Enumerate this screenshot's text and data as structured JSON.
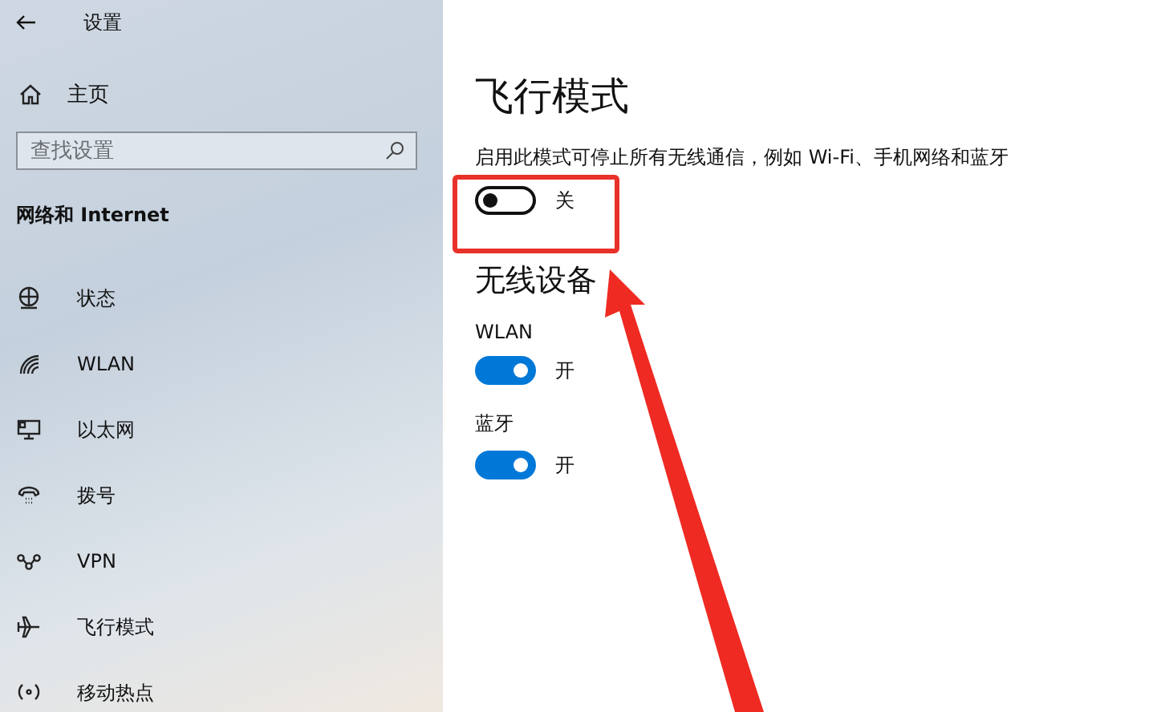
{
  "window": {
    "title": "设置"
  },
  "sidebar": {
    "home": "主页",
    "search": {
      "placeholder": "查找设置"
    },
    "section": "网络和 Internet",
    "items": [
      {
        "kind": "status",
        "label": "状态"
      },
      {
        "kind": "wlan",
        "label": "WLAN"
      },
      {
        "kind": "ethernet",
        "label": "以太网"
      },
      {
        "kind": "dialup",
        "label": "拨号"
      },
      {
        "kind": "vpn",
        "label": "VPN"
      },
      {
        "kind": "airplane",
        "label": "飞行模式"
      },
      {
        "kind": "hotspot",
        "label": "移动热点"
      }
    ]
  },
  "main": {
    "title": "飞行模式",
    "description": "启用此模式可停止所有无线通信，例如 Wi-Fi、手机网络和蓝牙",
    "airplane_toggle": {
      "on": false,
      "state_label": "关"
    },
    "devices_heading": "无线设备",
    "devices": [
      {
        "name": "WLAN",
        "on": true,
        "state_label": "开"
      },
      {
        "name": "蓝牙",
        "on": true,
        "state_label": "开"
      }
    ]
  }
}
